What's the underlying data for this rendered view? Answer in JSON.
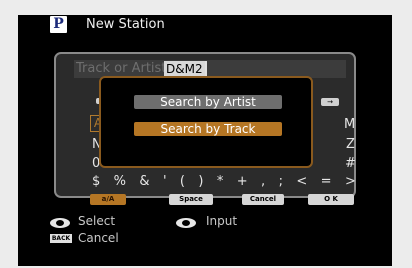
{
  "header": {
    "logo_letter": "P",
    "title": "New Station"
  },
  "keyboard": {
    "placeholder": "Track or Artist",
    "value": "D&M2",
    "nav_right_glyph": "→",
    "selected_key": "A",
    "left_keys": [
      "N",
      "0"
    ],
    "right_keys": [
      "M",
      "Z",
      "#"
    ],
    "symbols": [
      "$",
      "%",
      "&",
      "'",
      "(",
      ")",
      "*",
      "+",
      ",",
      ";",
      "<",
      "=",
      ">"
    ],
    "buttons": {
      "case": "a/A",
      "space": "Space",
      "cancel": "Cancel",
      "ok": "O K"
    }
  },
  "search_menu": {
    "options": [
      "Search by Artist",
      "Search by Track"
    ],
    "selected_index": 1
  },
  "legend": {
    "select_label": "Select",
    "input_label": "Input",
    "back_key": "BACK",
    "cancel_label": "Cancel"
  },
  "colors": {
    "accent": "#b57624",
    "background": "#000000"
  }
}
